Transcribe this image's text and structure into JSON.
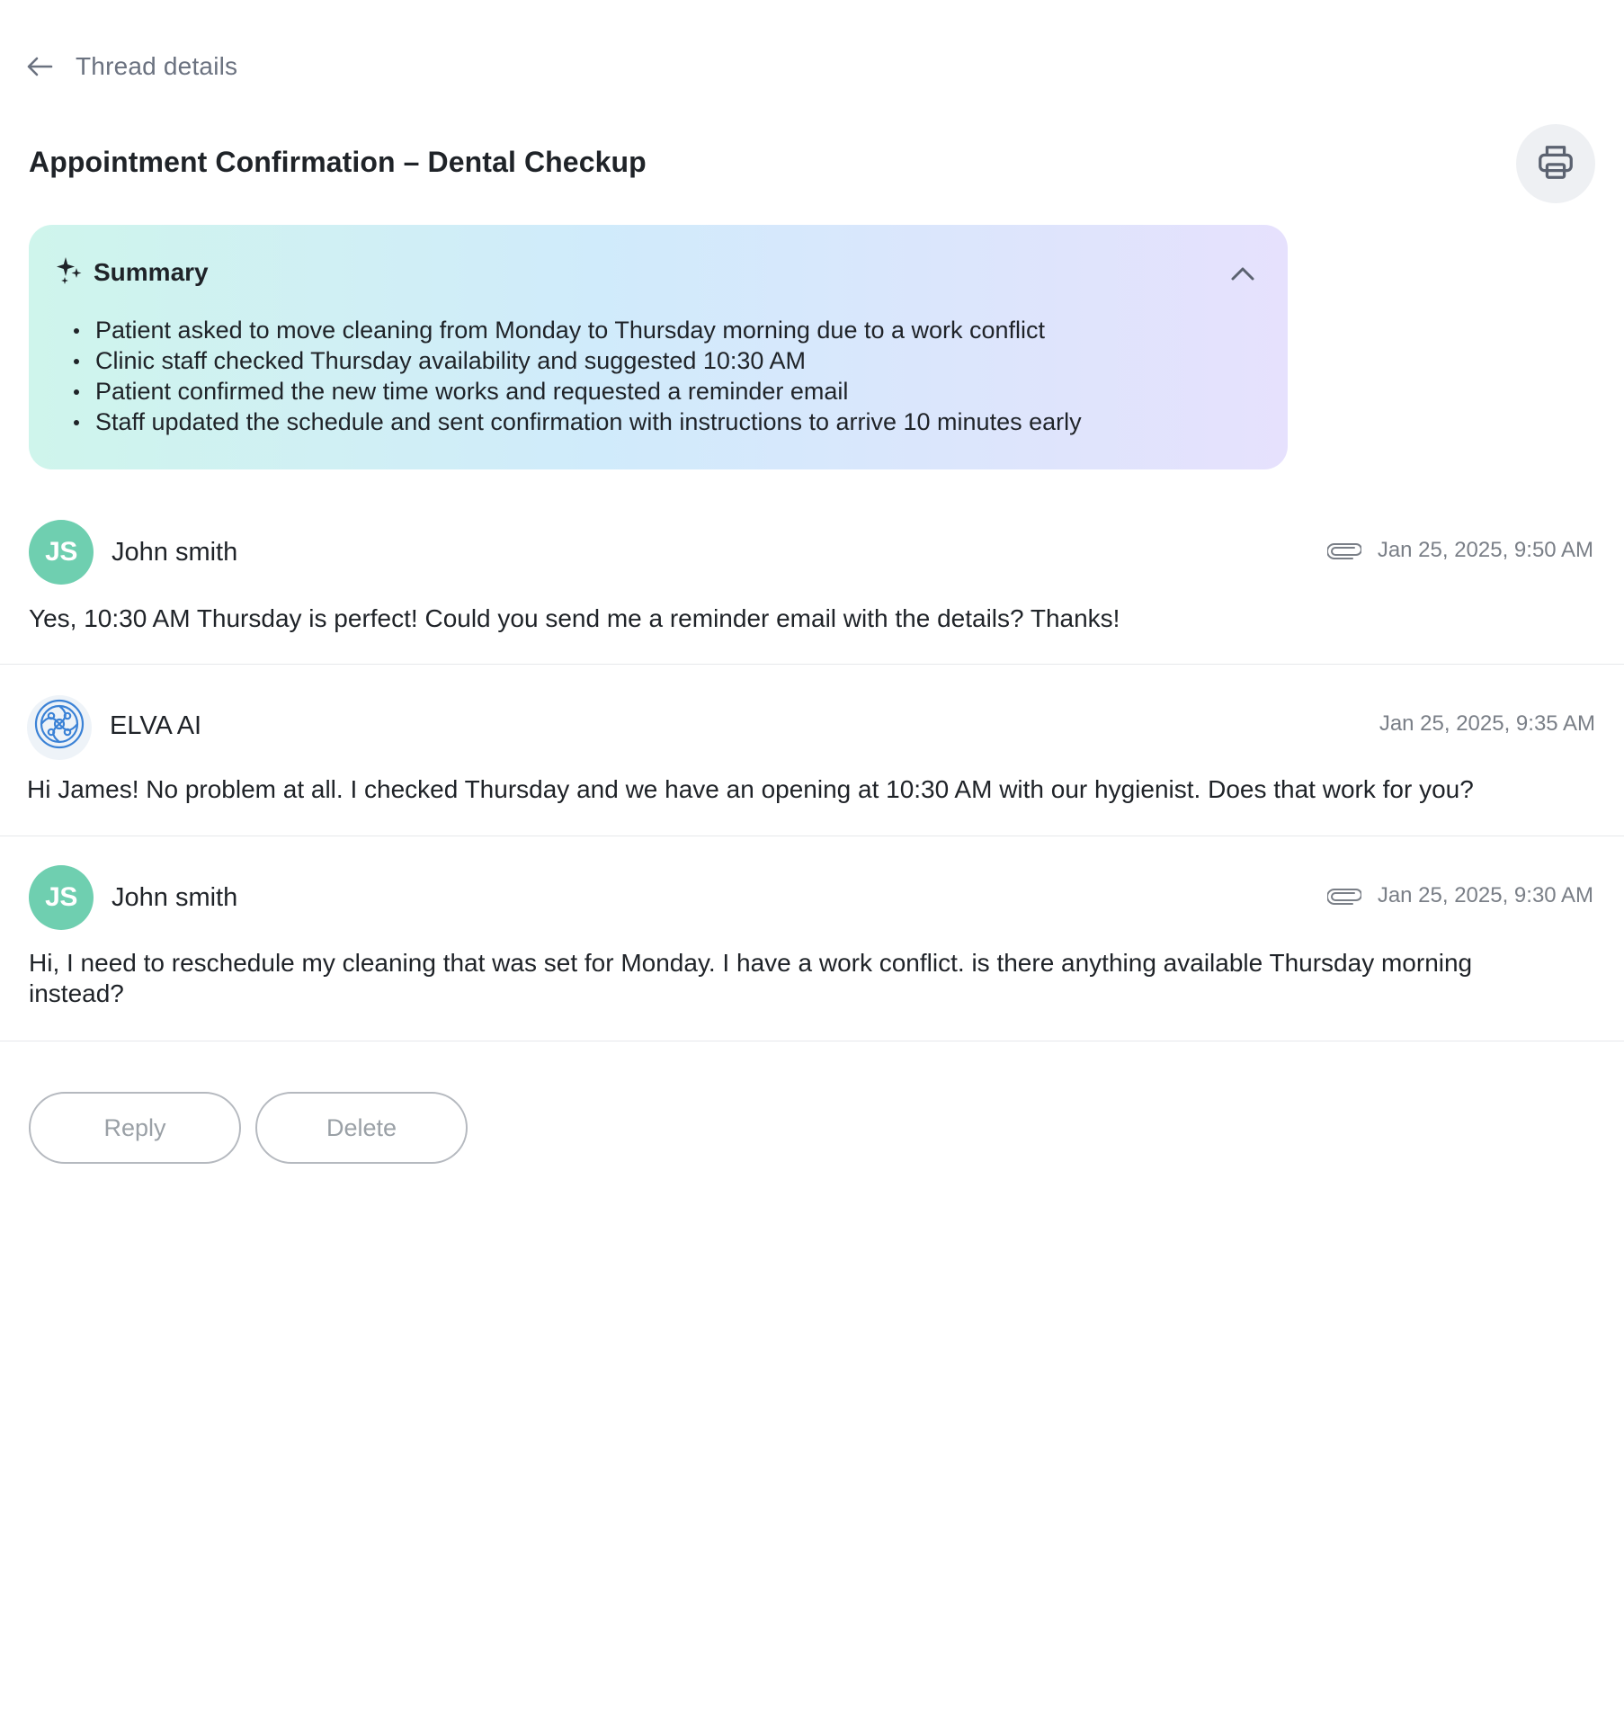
{
  "header": {
    "title": "Thread details",
    "back_icon": "arrow-left-icon"
  },
  "thread": {
    "subject": "Appointment Confirmation – Dental Checkup",
    "print_icon": "printer-icon"
  },
  "summary": {
    "title": "Summary",
    "icon": "sparkles-icon",
    "toggle_icon": "chevron-up-icon",
    "items": [
      "Patient asked to move cleaning from Monday to Thursday morning due to a work conflict",
      "Clinic staff checked Thursday availability and suggested 10:30 AM",
      "Patient confirmed the new time works and requested a reminder email",
      "Staff updated the schedule and sent confirmation with instructions to arrive 10 minutes early"
    ],
    "colors": {
      "start": "#cff5ec",
      "mid": "#d0ebfb",
      "end": "#e6e1fd"
    }
  },
  "messages": [
    {
      "sender": "John smith",
      "initials": "JS",
      "timestamp": "Jan 25, 2025, 9:50 AM",
      "has_attachment": true,
      "body": "Yes, 10:30 AM Thursday is perfect! Could you send me a reminder email with the details? Thanks!"
    },
    {
      "sender": "ELVA AI",
      "initials": "",
      "timestamp": "Jan 25, 2025, 9:35 AM",
      "has_attachment": false,
      "body": "Hi James! No problem at all. I checked Thursday and we have an opening at 10:30 AM with our hygienist. Does that work for you?"
    },
    {
      "sender": "John smith",
      "initials": "JS",
      "timestamp": "Jan 25, 2025, 9:30 AM",
      "has_attachment": true,
      "body": "Hi, I need to reschedule my cleaning that was set for Monday. I have a work conflict. is there anything available Thursday morning instead?"
    }
  ],
  "actions": {
    "reply_label": "Reply",
    "delete_label": "Delete"
  },
  "colors": {
    "avatar": "#6fcfb0",
    "ai_logo": "#3b82d6",
    "muted_text": "#7a7f87",
    "border": "#e6e8eb"
  }
}
